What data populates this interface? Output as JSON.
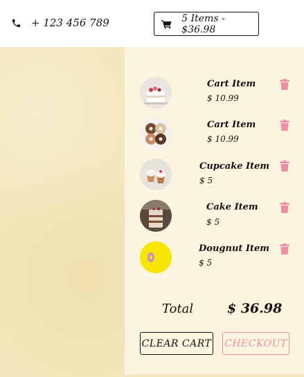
{
  "header": {
    "phone": "+ 123 456 789",
    "cart_summary": "5 Items - $36.98"
  },
  "cart": {
    "items": [
      {
        "name": "Cart Item",
        "price": "$ 10.99"
      },
      {
        "name": "Cart Item",
        "price": "$ 10.99"
      },
      {
        "name": "Cupcake Item",
        "price": "$ 5"
      },
      {
        "name": "Cake Item",
        "price": "$ 5"
      },
      {
        "name": "Dougnut Item",
        "price": "$ 5"
      }
    ],
    "total_label": "Total",
    "total_value": "$ 36.98",
    "clear_label": "CLEAR CART",
    "checkout_label": "CHECKOUT"
  },
  "colors": {
    "accent_pink": "#ef8fa6",
    "panel_bg": "#fbf4de",
    "side_bg": "#f4e7bd"
  }
}
